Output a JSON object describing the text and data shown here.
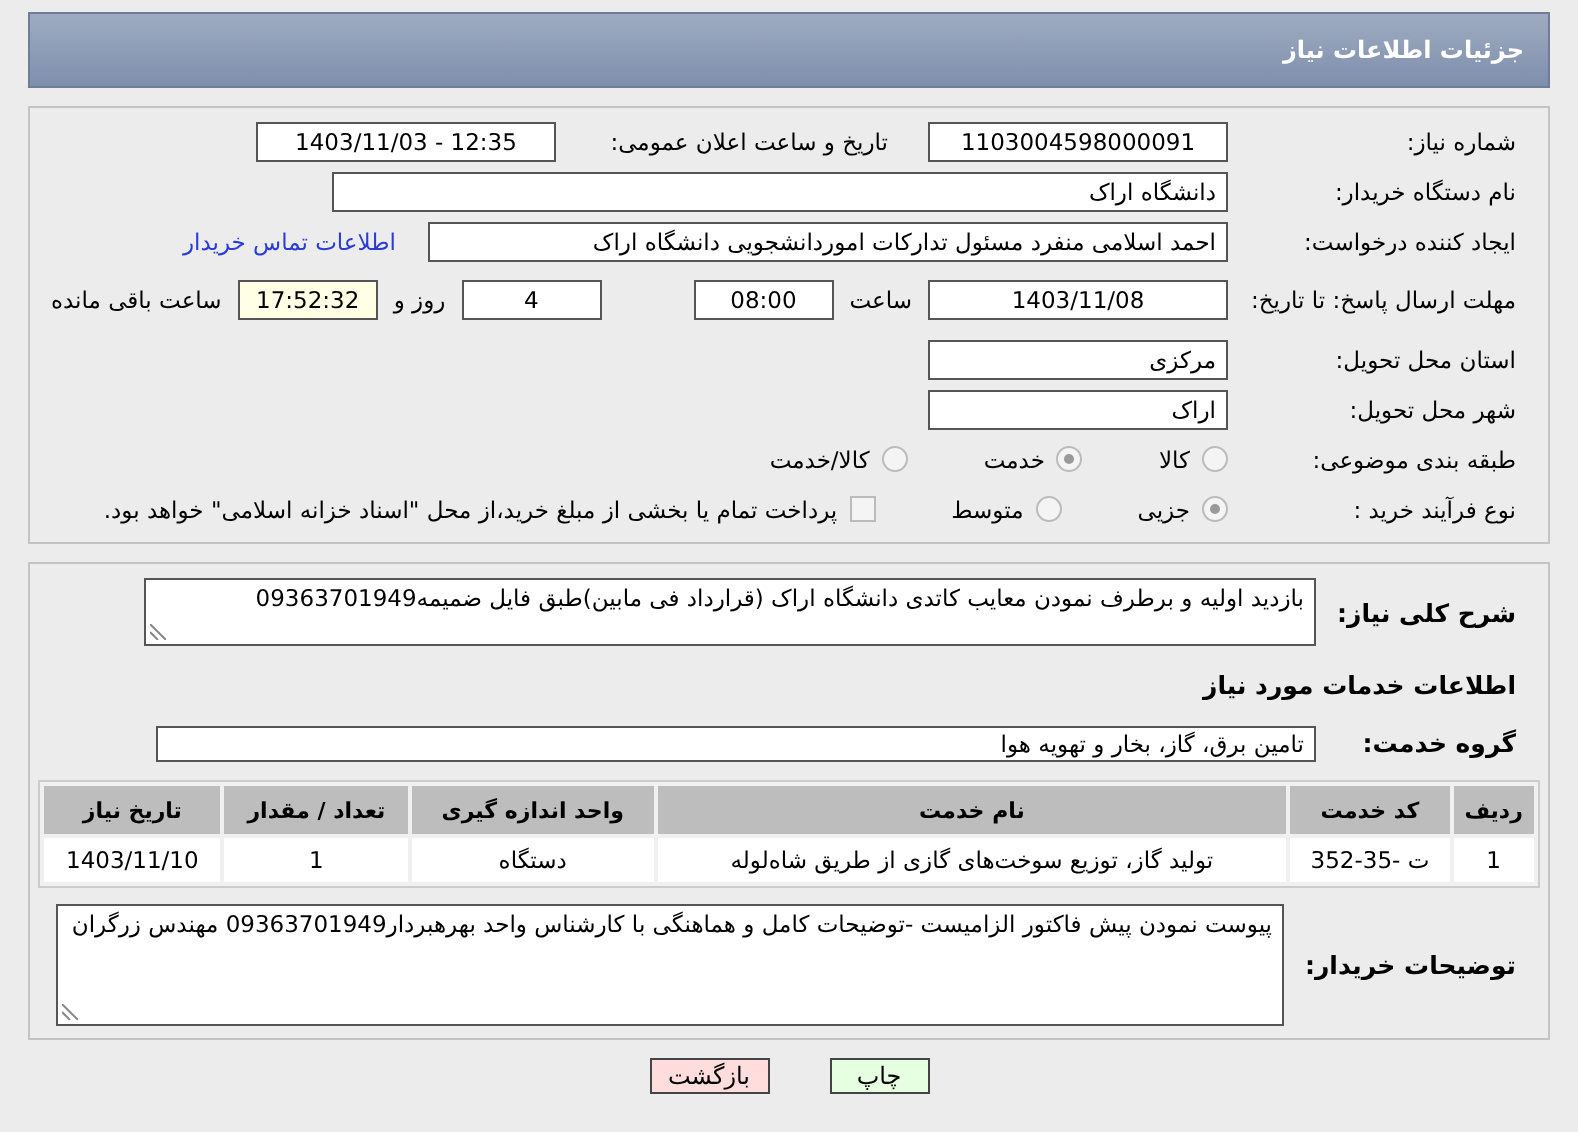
{
  "header": {
    "title": "جزئیات اطلاعات نیاز"
  },
  "need_number": {
    "label": "شماره نیاز:",
    "value": "1103004598000091"
  },
  "announce": {
    "label": "تاریخ و ساعت اعلان عمومی:",
    "value": "1403/11/03 - 12:35"
  },
  "buyer": {
    "label": "نام دستگاه خریدار:",
    "value": "دانشگاه اراک"
  },
  "creator": {
    "label": "ایجاد کننده درخواست:",
    "value": "احمد  اسلامی منفرد مسئول تدارکات اموردانشجویی دانشگاه اراک",
    "link": "اطلاعات تماس خریدار"
  },
  "deadline": {
    "label": "مهلت ارسال پاسخ: تا تاریخ:",
    "date": "1403/11/08",
    "time_label": "ساعت",
    "time": "08:00",
    "days": "4",
    "days_label": "روز و",
    "remaining": "17:52:32",
    "remaining_label": "ساعت باقی مانده"
  },
  "province": {
    "label": "استان محل تحویل:",
    "value": "مرکزی"
  },
  "city": {
    "label": "شهر محل تحویل:",
    "value": "اراک"
  },
  "category": {
    "label": "طبقه بندی موضوعی:",
    "options": [
      {
        "label": "کالا",
        "selected": false
      },
      {
        "label": "خدمت",
        "selected": true
      },
      {
        "label": "کالا/خدمت",
        "selected": false
      }
    ]
  },
  "process": {
    "label": "نوع فرآیند خرید :",
    "options": [
      {
        "label": "جزیی",
        "selected": true
      },
      {
        "label": "متوسط",
        "selected": false
      }
    ],
    "payment": {
      "label": "پرداخت تمام یا بخشی از مبلغ خرید،از محل \"اسناد خزانه اسلامی\" خواهد بود.",
      "checked": false
    }
  },
  "description": {
    "label": "شرح کلی نیاز:",
    "value": "بازدید اولیه و برطرف نمودن معایب کاتدی دانشگاه اراک (قرارداد فی مابین)طبق فایل ضمیمه09363701949"
  },
  "services_title": "اطلاعات خدمات مورد نیاز",
  "service_group": {
    "label": "گروه خدمت:",
    "value": "تامین برق، گاز، بخار و تهویه هوا"
  },
  "table": {
    "columns": [
      "ردیف",
      "کد خدمت",
      "نام خدمت",
      "واحد اندازه گیری",
      "تعداد / مقدار",
      "تاریخ نیاز"
    ],
    "rows": [
      [
        "1",
        "ت -35-352",
        "تولید گاز، توزیع سوخت‌های گازی از طریق شاه‌لوله",
        "دستگاه",
        "1",
        "1403/11/10"
      ]
    ]
  },
  "buyer_notes": {
    "label": "توضیحات خریدار:",
    "value": "پیوست نمودن پیش فاکتور الزامیست -توضیحات کامل و هماهنگی با کارشناس واحد بهرهبردار09363701949 مهندس زرگران"
  },
  "buttons": [
    {
      "label": "چاپ",
      "kind": "print"
    },
    {
      "label": "بازگشت",
      "kind": "back"
    }
  ]
}
